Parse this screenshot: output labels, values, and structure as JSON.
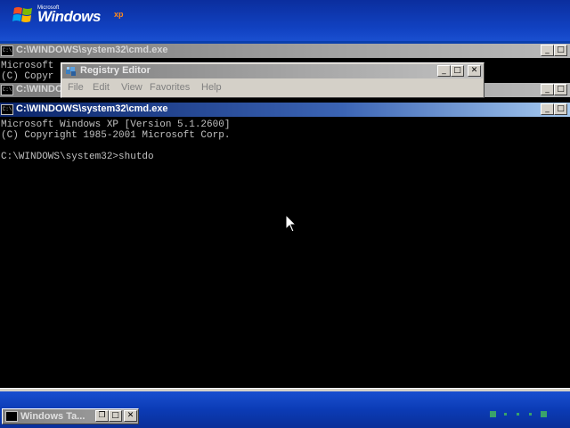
{
  "logo": {
    "brand_small": "Microsoft",
    "brand_main": "Windows",
    "brand_sup": "xp"
  },
  "windows": {
    "cmd_title": "C:\\WINDOWS\\system32\\cmd.exe",
    "cmd_icon": "C:\\",
    "bg_console_1_line1": "Microsoft",
    "bg_console_1_line2": "(C) Copyr",
    "bg_console_2_line1": "C:\\WINDO",
    "regedit": {
      "title": "Registry Editor",
      "menu": [
        "File",
        "Edit",
        "View",
        "Favorites",
        "Help"
      ]
    },
    "main_console": {
      "lines": [
        "Microsoft Windows XP [Version 5.1.2600]",
        "(C) Copyright 1985-2001 Microsoft Corp.",
        "",
        "C:\\WINDOWS\\system32>shutdo"
      ]
    }
  },
  "taskbar": {
    "minimized_window_title": "Windows Ta..."
  },
  "buttons": {
    "minimize": "_",
    "maximize": "□",
    "restore": "❐",
    "close": "✕"
  }
}
